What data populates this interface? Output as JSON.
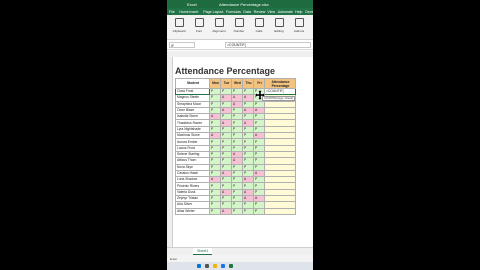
{
  "app": {
    "name": "Excel",
    "window_title": "Attendance Percentage.xlsx",
    "menu": [
      "File",
      "Home",
      "Insert",
      "Page Layout",
      "Formulas",
      "Data",
      "Review",
      "View",
      "Automate",
      "Help",
      "Developer"
    ],
    "ribbon_buttons": [
      "Clipboard",
      "Font",
      "Alignment",
      "Number",
      "Cells",
      "Editing",
      "Add-ins"
    ]
  },
  "formula_bar": {
    "name_box": "IF",
    "formula": "=COUNTIF("
  },
  "sheet": {
    "title": "Attendance Percentage",
    "headers": [
      "Student",
      "Mon",
      "Tue",
      "Wed",
      "Thu",
      "Fri",
      "Attendance Percentage"
    ],
    "rows": [
      {
        "name": "Clara Frost",
        "days": [
          "P",
          "P",
          "P",
          "P",
          "P"
        ],
        "pct": "=COUNTIF("
      },
      {
        "name": "Magnus Steele",
        "days": [
          "P",
          "A",
          "A",
          "A",
          "P"
        ],
        "pct": ""
      },
      {
        "name": "Seraphina Moon",
        "days": [
          "P",
          "P",
          "A",
          "P",
          "P"
        ],
        "pct": ""
      },
      {
        "name": "Orion Blaze",
        "days": [
          "P",
          "A",
          "P",
          "A",
          "A"
        ],
        "pct": ""
      },
      {
        "name": "Isabella Storm",
        "days": [
          "A",
          "P",
          "P",
          "P",
          "P"
        ],
        "pct": ""
      },
      {
        "name": "Thaddeus Raven",
        "days": [
          "P",
          "A",
          "P",
          "A",
          "P"
        ],
        "pct": ""
      },
      {
        "name": "Lyra Nightshade",
        "days": [
          "P",
          "P",
          "P",
          "P",
          "P"
        ],
        "pct": ""
      },
      {
        "name": "Maximus Stone",
        "days": [
          "A",
          "P",
          "P",
          "P",
          "A"
        ],
        "pct": ""
      },
      {
        "name": "Aurora Ember",
        "days": [
          "P",
          "P",
          "P",
          "P",
          "P"
        ],
        "pct": ""
      },
      {
        "name": "Lucius Frost",
        "days": [
          "P",
          "P",
          "P",
          "P",
          "P"
        ],
        "pct": ""
      },
      {
        "name": "Selene Starling",
        "days": [
          "P",
          "P",
          "A",
          "P",
          "P"
        ],
        "pct": ""
      },
      {
        "name": "Atticus Thorn",
        "days": [
          "P",
          "P",
          "A",
          "P",
          "P"
        ],
        "pct": ""
      },
      {
        "name": "Nova Skye",
        "days": [
          "P",
          "P",
          "P",
          "P",
          "P"
        ],
        "pct": ""
      },
      {
        "name": "Cassius Hawk",
        "days": [
          "P",
          "A",
          "P",
          "P",
          "A"
        ],
        "pct": ""
      },
      {
        "name": "Luna Shadow",
        "days": [
          "A",
          "P",
          "P",
          "A",
          "P"
        ],
        "pct": ""
      },
      {
        "name": "Phoenix Rivers",
        "days": [
          "P",
          "P",
          "P",
          "P",
          "P"
        ],
        "pct": ""
      },
      {
        "name": "Valeria Dusk",
        "days": [
          "P",
          "A",
          "P",
          "A",
          "P"
        ],
        "pct": ""
      },
      {
        "name": "Zephyr Tristan",
        "days": [
          "P",
          "P",
          "P",
          "A",
          "A"
        ],
        "pct": ""
      },
      {
        "name": "Aria Silver",
        "days": [
          "P",
          "P",
          "P",
          "P",
          "P"
        ],
        "pct": ""
      },
      {
        "name": "Atlas Winter",
        "days": [
          "P",
          "A",
          "P",
          "P",
          "P"
        ],
        "pct": ""
      }
    ]
  },
  "tooltip": "COUNTIF(range, criteria)",
  "sheet_tab": "Sheet1",
  "status": "Enter",
  "colors": {
    "accent": "#217346",
    "present": "#d3f5c8",
    "absent": "#f6c1d2",
    "header": "#f4c27f"
  }
}
